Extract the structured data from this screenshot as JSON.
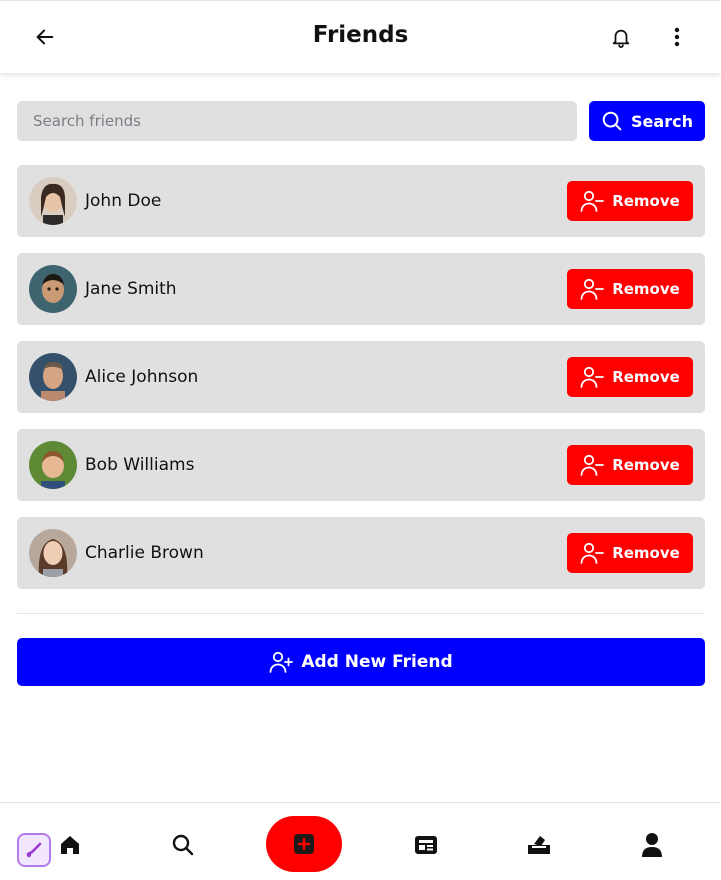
{
  "header": {
    "title": "Friends"
  },
  "search": {
    "placeholder": "Search friends",
    "button_label": "Search"
  },
  "friends": [
    {
      "name": "John Doe",
      "remove_label": "Remove",
      "avatar_color": "#c9b8a8"
    },
    {
      "name": "Jane Smith",
      "remove_label": "Remove",
      "avatar_color": "#4a6b6e"
    },
    {
      "name": "Alice Johnson",
      "remove_label": "Remove",
      "avatar_color": "#3b5a78"
    },
    {
      "name": "Bob Williams",
      "remove_label": "Remove",
      "avatar_color": "#6f8f3a"
    },
    {
      "name": "Charlie Brown",
      "remove_label": "Remove",
      "avatar_color": "#8a6a5a"
    }
  ],
  "add_button": {
    "label": "Add New Friend"
  },
  "bottom_nav": {
    "items": [
      "home-icon",
      "search-icon",
      "add-post-icon",
      "news-icon",
      "vote-icon",
      "profile-icon"
    ]
  },
  "colors": {
    "primary": "#0000ff",
    "danger": "#ff0000",
    "card": "#e0e0e0"
  }
}
